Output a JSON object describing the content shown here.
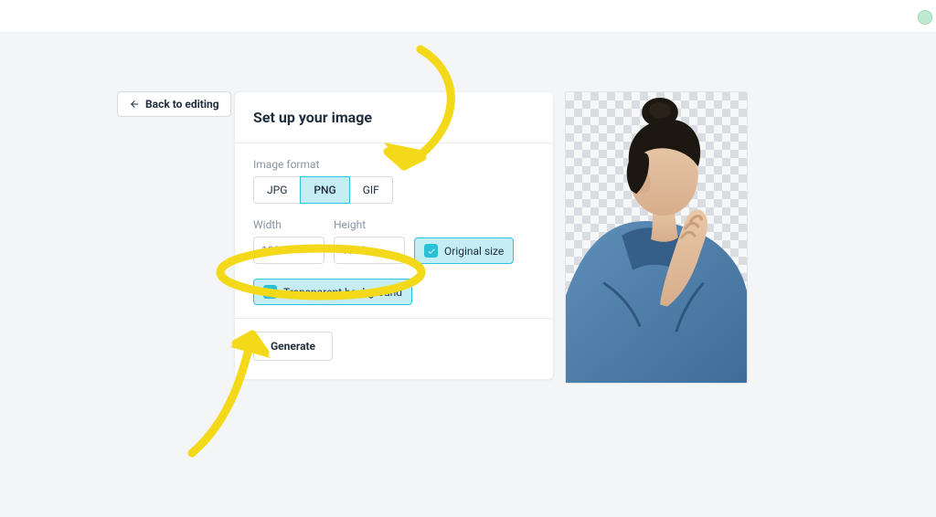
{
  "nav": {
    "back_label": "Back to editing"
  },
  "panel": {
    "title": "Set up your image",
    "format_label": "Image format",
    "formats": {
      "jpg": "JPG",
      "png": "PNG",
      "gif": "GIF"
    },
    "selected_format": "PNG",
    "width_label": "Width",
    "height_label": "Height",
    "width_value": "1080",
    "height_value": "1920",
    "original_size_label": "Original size",
    "original_size_checked": true,
    "transparent_label": "Transparent background",
    "transparent_checked": true,
    "generate_label": "Generate"
  },
  "annotations": {
    "highlight_targets": [
      "png-format-button",
      "transparent-bg-chip",
      "generate-button"
    ],
    "color": "#f4d91a"
  },
  "preview": {
    "description": "photo-subject-on-transparent-background"
  }
}
